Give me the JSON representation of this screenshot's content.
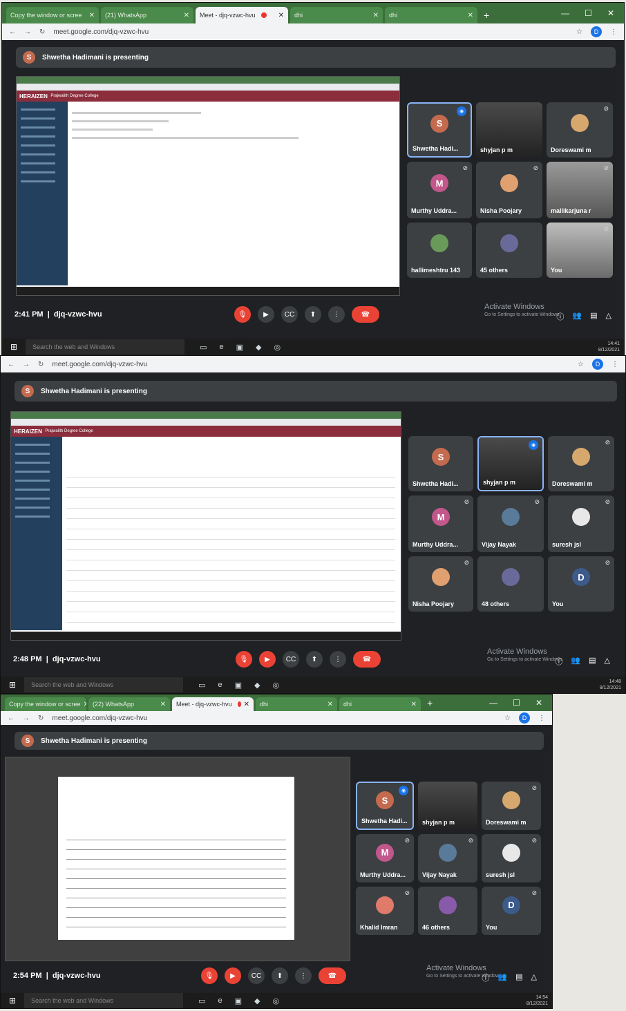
{
  "meeting": {
    "presenter": "Shwetha Hadimani is presenting",
    "presenter_initial": "S",
    "code": "djq-vzwc-hvu",
    "url": "meet.google.com/djq-vzwc-hvu"
  },
  "watermark": {
    "title": "Activate Windows",
    "sub": "Go to Settings to activate Windows."
  },
  "taskbar": {
    "search": "Search the web and Windows"
  },
  "shared_app": {
    "brand": "HERAIZEN",
    "college": "Prajwalith Degree College"
  },
  "shots": [
    {
      "tabs": [
        {
          "label": "Copy the window or scree"
        },
        {
          "label": "(21) WhatsApp"
        },
        {
          "label": "Meet - djq-vzwc-hvu"
        },
        {
          "label": "dhi"
        },
        {
          "label": "dhi"
        }
      ],
      "time": "2:41 PM",
      "tray_time": "14:41",
      "tray_date": "8/12/2021",
      "participants": [
        {
          "name": "Shwetha Hadi...",
          "initial": "S",
          "color": "#c46a4e"
        },
        {
          "name": "shyjan p m",
          "initial": ""
        },
        {
          "name": "Doreswami m",
          "initial": "",
          "color": "#d7a86e"
        },
        {
          "name": "Murthy Uddra...",
          "initial": "M",
          "color": "#c2578b"
        },
        {
          "name": "Nisha Poojary",
          "initial": "",
          "color": "#e0a070"
        },
        {
          "name": "mallikarjuna r",
          "initial": ""
        },
        {
          "name": "hallimeshtru 143",
          "initial": "",
          "color": "#6a9a5a"
        },
        {
          "name": "45 others",
          "initial": "",
          "color": "#6a6a9a"
        },
        {
          "name": "You",
          "initial": ""
        }
      ]
    },
    {
      "time": "2:48 PM",
      "tray_time": "14:48",
      "tray_date": "8/12/2021",
      "participants": [
        {
          "name": "Shwetha Hadi...",
          "initial": "S",
          "color": "#c46a4e"
        },
        {
          "name": "shyjan p m",
          "initial": ""
        },
        {
          "name": "Doreswami m",
          "initial": "",
          "color": "#d7a86e"
        },
        {
          "name": "Murthy Uddra...",
          "initial": "M",
          "color": "#c2578b"
        },
        {
          "name": "Vijay Nayak",
          "initial": "",
          "color": "#5a7a9a"
        },
        {
          "name": "suresh jsl",
          "initial": "",
          "color": "#e8e8e8"
        },
        {
          "name": "Nisha Poojary",
          "initial": "",
          "color": "#e0a070"
        },
        {
          "name": "48 others",
          "initial": "",
          "color": "#6a6a9a"
        },
        {
          "name": "You",
          "initial": "D",
          "color": "#3c5a8a"
        }
      ]
    },
    {
      "tabs": [
        {
          "label": "Copy the window or scree"
        },
        {
          "label": "(22) WhatsApp"
        },
        {
          "label": "Meet - djq-vzwc-hvu"
        },
        {
          "label": "dhi"
        },
        {
          "label": "dhi"
        }
      ],
      "time": "2:54 PM",
      "tray_time": "14:54",
      "tray_date": "8/12/2021",
      "participants": [
        {
          "name": "Shwetha Hadi...",
          "initial": "S",
          "color": "#c46a4e"
        },
        {
          "name": "shyjan p m",
          "initial": ""
        },
        {
          "name": "Doreswami m",
          "initial": "",
          "color": "#d7a86e"
        },
        {
          "name": "Murthy Uddra...",
          "initial": "M",
          "color": "#c2578b"
        },
        {
          "name": "Vijay Nayak",
          "initial": "",
          "color": "#5a7a9a"
        },
        {
          "name": "suresh jsl",
          "initial": "",
          "color": "#e8e8e8"
        },
        {
          "name": "Khalid Imran",
          "initial": "",
          "color": "#e07a6a"
        },
        {
          "name": "46 others",
          "initial": "",
          "color": "#8a5aaa"
        },
        {
          "name": "You",
          "initial": "D",
          "color": "#3c5a8a"
        }
      ]
    }
  ]
}
